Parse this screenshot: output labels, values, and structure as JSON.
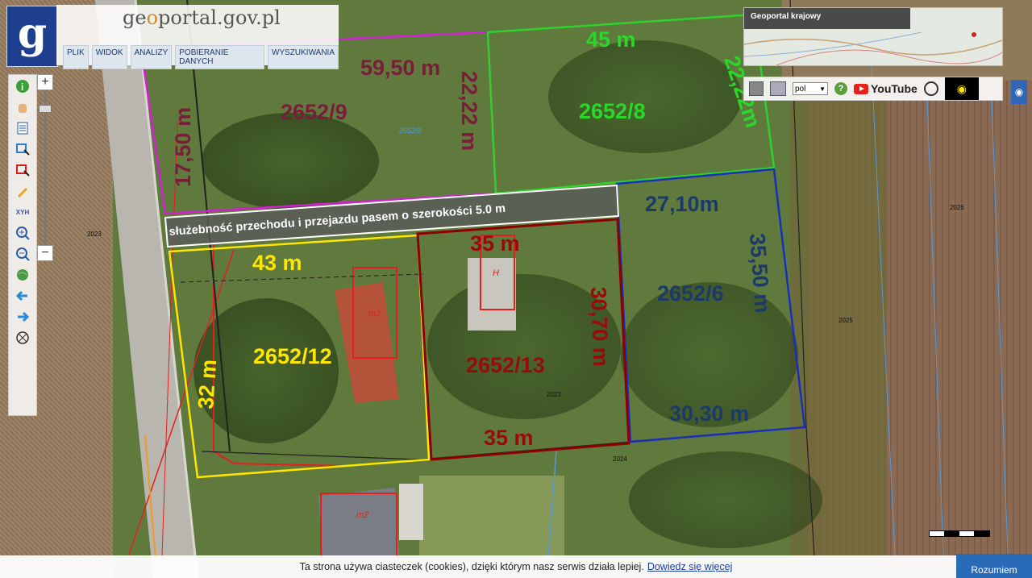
{
  "header": {
    "logo_letter": "g",
    "site_title_pre": "ge",
    "site_title_o": "o",
    "site_title_post": "portal.gov.pl",
    "menu": [
      "PLIK",
      "WIDOK",
      "ANALIZY",
      "POBIERANIE DANYCH",
      "WYSZUKIWANIA"
    ]
  },
  "overview": {
    "title": "Geoportal krajowy"
  },
  "tools_right": {
    "language": "pol",
    "youtube_label": "YouTube"
  },
  "map_labels": {
    "p9_number": "2652/9",
    "p9_top": "59,50 m",
    "p9_right": "22,22 m",
    "p9_left": "17,50 m",
    "p8_number": "2652/8",
    "p8_top": "45 m",
    "p8_right": "22,22m",
    "p6_number": "2652/6",
    "p6_top": "27,10m",
    "p6_right": "35,50 m",
    "p6_bottom": "30,30 m",
    "p12_number": "2652/12",
    "p12_top": "43 m",
    "p12_left": "32 m",
    "p13_number": "2652/13",
    "p13_top": "35 m",
    "p13_right": "30,70 m",
    "p13_bottom": "35 m",
    "easement": "służebność przechodu i przejazdu pasem o szerokości 5.0 m",
    "building_m2_a": "m2",
    "building_m2_b": "m2",
    "building_h": "H"
  },
  "colors": {
    "p9": "#d21fd2",
    "p8": "#2ed12e",
    "p6": "#1a2fb8",
    "p12": "#ffe600",
    "p13": "#8b0000",
    "p9_text": "#7a1d3a",
    "p8_text": "#29d829",
    "p6_text": "#1b3a6a",
    "p12_text": "#ffe600",
    "p13_text": "#9b0a0a"
  },
  "cookie": {
    "text": "Ta strona używa ciasteczek (cookies), dzięki którym nasz serwis działa lepiej.",
    "link": "Dowiedz się więcej",
    "button": "Rozumiem"
  }
}
